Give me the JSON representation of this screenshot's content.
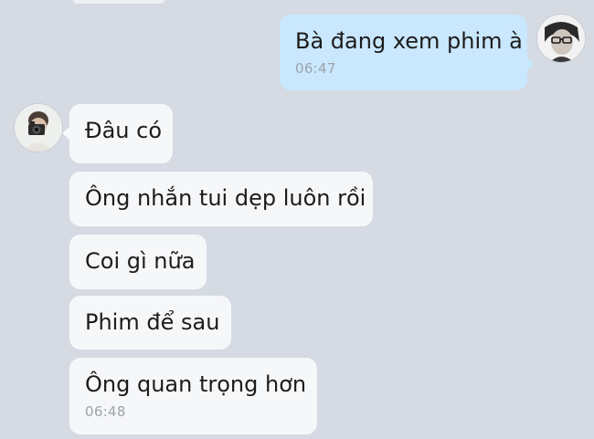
{
  "conversation": {
    "outgoing": {
      "text": "Bà đang xem phim à",
      "time": "06:47"
    },
    "incoming": [
      {
        "text": "Đâu có"
      },
      {
        "text": "Ông nhắn tui dẹp luôn rồi"
      },
      {
        "text": "Coi gì nữa"
      },
      {
        "text": "Phim để sau"
      },
      {
        "text": "Ông quan trọng hơn",
        "time": "06:48"
      }
    ]
  },
  "colors": {
    "background": "#d5dae3",
    "outgoing_bubble": "#c9e7fd",
    "incoming_bubble": "#f6f7f9",
    "timestamp": "#9da3ab"
  },
  "icons": {
    "own_avatar": "avatar-glasses-portrait",
    "friend_avatar": "avatar-camera-portrait"
  }
}
